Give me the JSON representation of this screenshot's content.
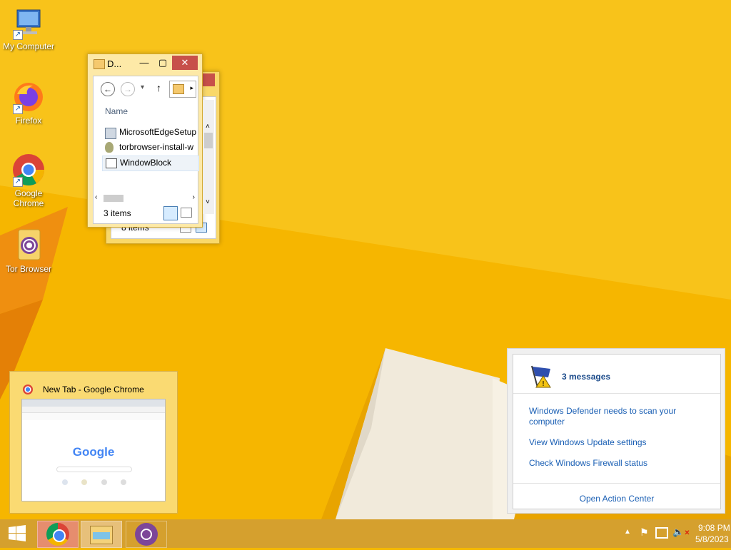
{
  "desktop": {
    "icons": [
      {
        "label": "My Computer",
        "icon": "computer-icon"
      },
      {
        "label": "Firefox",
        "icon": "firefox-icon"
      },
      {
        "label": "Google\nChrome",
        "icon": "chrome-icon"
      },
      {
        "label": "Tor Browser",
        "icon": "tor-browser-icon"
      }
    ]
  },
  "explorer_front": {
    "title": "D...",
    "column_header": "Name",
    "files": [
      {
        "name": "MicrosoftEdgeSetup",
        "icon": "installer-icon"
      },
      {
        "name": "torbrowser-install-w",
        "icon": "tor-installer-icon"
      },
      {
        "name": "WindowBlock",
        "icon": "application-icon"
      }
    ],
    "status": "3 items"
  },
  "explorer_back": {
    "status": "8 items"
  },
  "thumbnail": {
    "title": "New Tab - Google Chrome",
    "logo_text": "Google"
  },
  "notification": {
    "header": "3 messages",
    "items": [
      "Windows Defender needs to scan your computer",
      "View Windows Update settings",
      "Check Windows Firewall status"
    ],
    "footer": "Open Action Center"
  },
  "taskbar": {
    "apps": [
      "chrome-icon",
      "file-explorer-icon",
      "tor-browser-icon"
    ],
    "time": "9:08 PM",
    "date": "5/8/2023"
  },
  "colors": {
    "wallpaper": "#f5b800",
    "taskbar": "#d5a02e",
    "link": "#1a5fb4"
  }
}
